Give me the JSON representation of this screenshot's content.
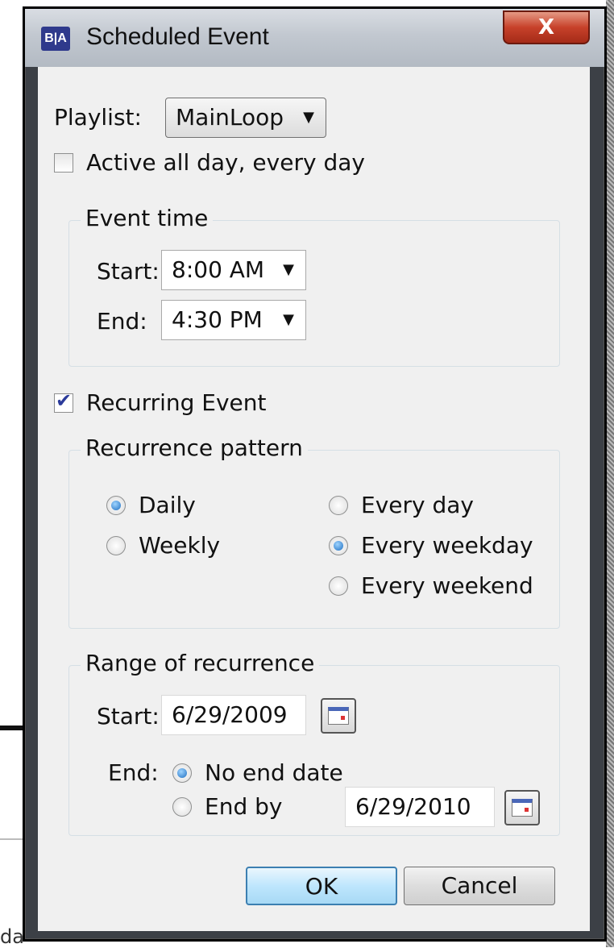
{
  "window": {
    "title": "Scheduled Event",
    "app_icon": "B|A",
    "close_symbol": "X"
  },
  "playlist": {
    "label": "Playlist:",
    "value": "MainLoop"
  },
  "active_all_day": {
    "label": "Active all day, every day",
    "checked": false
  },
  "event_time": {
    "title": "Event time",
    "start_label": "Start:",
    "start_value": "8:00 AM",
    "end_label": "End:",
    "end_value": "4:30 PM"
  },
  "recurring": {
    "label": "Recurring Event",
    "checked": true
  },
  "recurrence_pattern": {
    "title": "Recurrence pattern",
    "daily": "Daily",
    "weekly": "Weekly",
    "every_day": "Every day",
    "every_weekday": "Every weekday",
    "every_weekend": "Every weekend",
    "selected_frequency": "Daily",
    "selected_days": "Every weekday"
  },
  "range": {
    "title": "Range of recurrence",
    "start_label": "Start:",
    "start_value": "6/29/2009",
    "end_label": "End:",
    "no_end_date": "No end date",
    "end_by": "End by",
    "end_by_value": "6/29/2010",
    "selected_end": "No end date"
  },
  "buttons": {
    "ok": "OK",
    "cancel": "Cancel"
  },
  "background": {
    "fragment_text": "da"
  },
  "icons": {
    "dropdown_arrow": "▼",
    "checkmark": "✔"
  },
  "colors": {
    "title_bar": "#c2c8d0",
    "close_button": "#c7412a",
    "ok_button": "#bee6fd",
    "client": "#f0f0f0"
  }
}
